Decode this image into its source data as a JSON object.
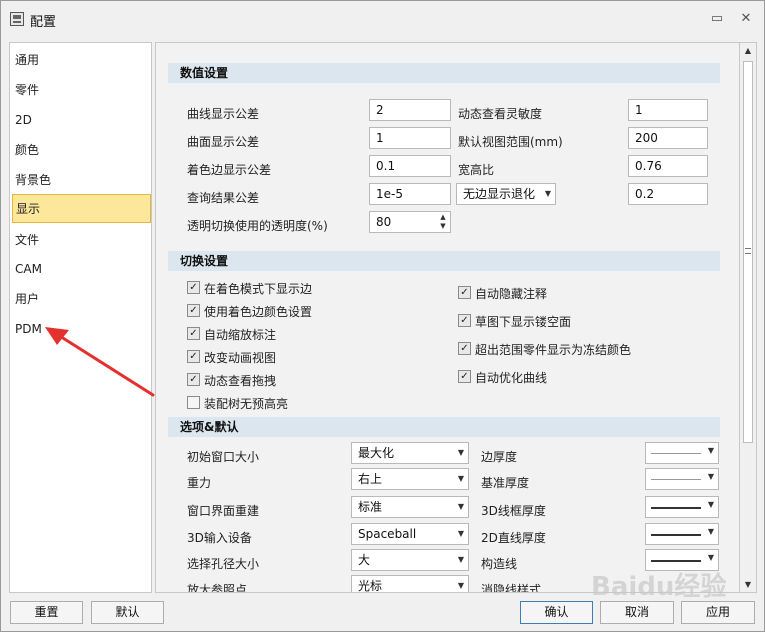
{
  "window": {
    "title": "配置"
  },
  "sidebar": {
    "items": [
      {
        "label": "通用"
      },
      {
        "label": "零件"
      },
      {
        "label": "2D"
      },
      {
        "label": "颜色"
      },
      {
        "label": "背景色"
      },
      {
        "label": "显示"
      },
      {
        "label": "文件"
      },
      {
        "label": "CAM"
      },
      {
        "label": "用户"
      },
      {
        "label": "PDM"
      }
    ],
    "selected": "显示"
  },
  "numeric": {
    "header": "数值设置",
    "curve_tol_label": "曲线显示公差",
    "curve_tol": "2",
    "surf_tol_label": "曲面显示公差",
    "surf_tol": "1",
    "shade_edge_tol_label": "着色边显示公差",
    "shade_edge_tol": "0.1",
    "query_tol_label": "查询结果公差",
    "query_tol": "1e-5",
    "transparency_label": "透明切换使用的透明度(%)",
    "transparency": "80",
    "dyn_sens_label": "动态查看灵敏度",
    "dyn_sens": "1",
    "view_range_label": "默认视图范围(mm)",
    "view_range": "200",
    "aspect_label": "宽高比",
    "aspect": "0.76",
    "edge_fallback": "无边显示退化",
    "edge_fallback_val": "0.2"
  },
  "toggles": {
    "header": "切换设置",
    "left": [
      {
        "label": "在着色模式下显示边",
        "checked": true
      },
      {
        "label": "使用着色边颜色设置",
        "checked": true
      },
      {
        "label": "自动缩放标注",
        "checked": true
      },
      {
        "label": "改变动画视图",
        "checked": true
      },
      {
        "label": "动态查看拖拽",
        "checked": true
      },
      {
        "label": "装配树无预高亮",
        "checked": false
      }
    ],
    "right": [
      {
        "label": "自动隐藏注释",
        "checked": true
      },
      {
        "label": "草图下显示镂空面",
        "checked": true
      },
      {
        "label": "超出范围零件显示为冻结颜色",
        "checked": true
      },
      {
        "label": "自动优化曲线",
        "checked": true
      }
    ]
  },
  "options": {
    "header": "选项&默认",
    "rows": [
      {
        "label": "初始窗口大小",
        "value": "最大化",
        "rlabel": "边厚度"
      },
      {
        "label": "重力",
        "value": "右上",
        "rlabel": "基准厚度"
      },
      {
        "label": "窗口界面重建",
        "value": "标准",
        "rlabel": "3D线框厚度"
      },
      {
        "label": "3D输入设备",
        "value": "Spaceball",
        "rlabel": "2D直线厚度"
      },
      {
        "label": "选择孔径大小",
        "value": "大",
        "rlabel": "构造线"
      },
      {
        "label": "放大参照点",
        "value": "光标",
        "rlabel": "消隐线样式"
      }
    ]
  },
  "buttons": {
    "reset": "重置",
    "default": "默认",
    "ok": "确认",
    "cancel": "取消",
    "apply": "应用"
  },
  "watermark": "Baidu经验",
  "colors": {
    "accent": "#fce79a",
    "section": "#dce6ef",
    "arrow": "#e53030"
  }
}
